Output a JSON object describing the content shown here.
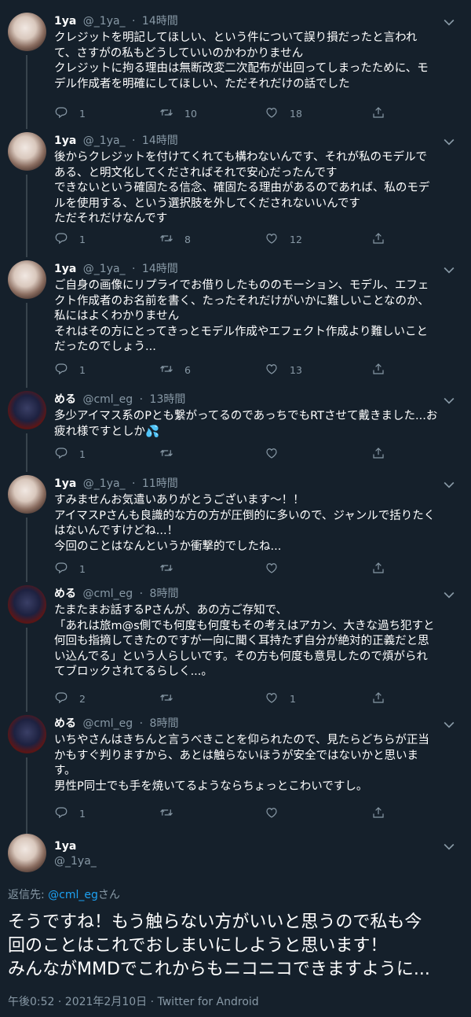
{
  "tweets": [
    {
      "name": "1ya",
      "handle": "@_1ya_",
      "time": "14時間",
      "avatar": "avatar-1ya",
      "text": "クレジットを明記してほしい、という件について誤り損だったと言われ\nて、さすがの私もどうしていいのかわかりません\nクレジットに拘る理由は無断改変二次配布が出回ってしまったために、モ\nデル作成者を明確にしてほしい、ただそれだけの話でした",
      "replies": "1",
      "retweets": "10",
      "likes": "18"
    },
    {
      "name": "1ya",
      "handle": "@_1ya_",
      "time": "14時間",
      "avatar": "avatar-1ya",
      "text": "後からクレジットを付けてくれても構わないんです、それが私のモデルで\nある、と明文化してくださればそれで安心だったんです\nできないという確固たる信念、確固たる理由があるのであれば、私のモデ\nルを使用する、という選択肢を外してくだされないいんです\nただそれだけなんです",
      "replies": "1",
      "retweets": "8",
      "likes": "12"
    },
    {
      "name": "1ya",
      "handle": "@_1ya_",
      "time": "14時間",
      "avatar": "avatar-1ya",
      "text": "ご自身の画像にリプライでお借りしたもののモーション、モデル、エフェ\nクト作成者のお名前を書く、たったそれだけがいかに難しいことなのか、\n私にはよくわかりません\nそれはその方にとってきっとモデル作成やエフェクト作成より難しいこと\nだったのでしょう...",
      "replies": "1",
      "retweets": "6",
      "likes": "13"
    },
    {
      "name": "める",
      "handle": "@cml_eg",
      "time": "13時間",
      "avatar": "avatar-meru",
      "text": "多少アイマス系のPとも繋がってるのであっちでもRTさせて戴きました...お\n疲れ様ですとしか💦",
      "replies": "1",
      "retweets": "",
      "likes": ""
    },
    {
      "name": "1ya",
      "handle": "@_1ya_",
      "time": "11時間",
      "avatar": "avatar-1ya",
      "text": "すみませんお気遣いありがとうございます～！！\nアイマスPさんも良識的な方の方が圧倒的に多いので、ジャンルで括りたく\nはないんですけどね...！\n今回のことはなんというか衝撃的でしたね...",
      "replies": "1",
      "retweets": "",
      "likes": ""
    },
    {
      "name": "める",
      "handle": "@cml_eg",
      "time": "8時間",
      "avatar": "avatar-meru",
      "text": "たまたまお話するPさんが、あの方ご存知で、\n「あれは旅m@s側でも何度も何度もその考えはアカン、大きな過ち犯すと\n何回も指摘してきたのですが一向に聞く耳持たず自分が絶対的正義だと思\nい込んでる」という人らしいです。その方も何度も意見したので煩がられ\nてブロックされてるらしく...。",
      "replies": "2",
      "retweets": "",
      "likes": "1"
    },
    {
      "name": "める",
      "handle": "@cml_eg",
      "time": "8時間",
      "avatar": "avatar-meru",
      "text": "いちやさんはきちんと言うべきことを仰られたので、見たらどちらが正当\nかもすぐ判りますから、あとは触らないほうが安全ではないかと思いま\nす。\n男性P同士でも手を焼いてるようならちょっとこわいですし。",
      "replies": "1",
      "retweets": "",
      "likes": ""
    }
  ],
  "main": {
    "name": "1ya",
    "handle": "@_1ya_",
    "reply_prefix": "返信先: ",
    "reply_user": "@cml_eg",
    "reply_suffix": "さん",
    "text": "そうですね！もう触らない方がいいと思うので私も今\n回のことはこれでおしまいにしようと思います！\nみんながMMDでこれからもニコニコできますように...",
    "timestamp": "午後0:52 · 2021年2月10日 · Twitter for Android"
  }
}
